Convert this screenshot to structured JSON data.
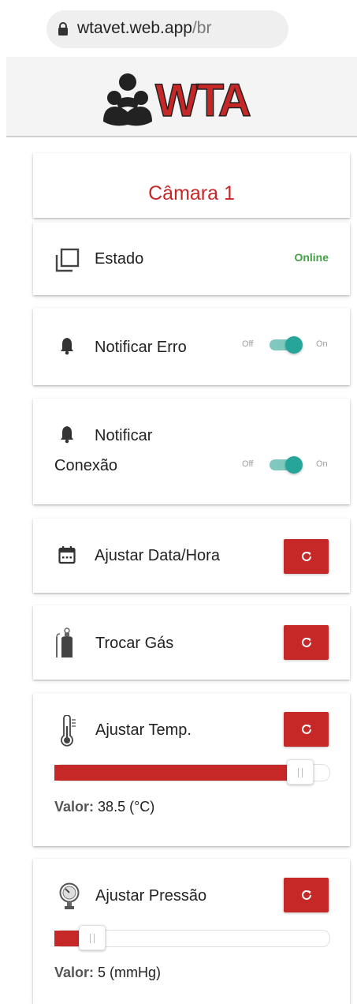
{
  "browser": {
    "url_domain": "wtavet.web.app",
    "url_path": "/br"
  },
  "header": {
    "logo_text": "WTA"
  },
  "chamber": {
    "title": "Câmara 1"
  },
  "status": {
    "label": "Estado",
    "value": "Online",
    "value_color": "#43a047"
  },
  "notify_error": {
    "label": "Notificar Erro",
    "off_label": "Off",
    "on_label": "On",
    "enabled": true
  },
  "notify_connection": {
    "label_line1": "Notificar",
    "label_line2": "Conexão",
    "off_label": "Off",
    "on_label": "On",
    "enabled": true
  },
  "set_datetime": {
    "label": "Ajustar Data/Hora"
  },
  "change_gas": {
    "label": "Trocar Gás"
  },
  "temperature": {
    "label": "Ajustar Temp.",
    "value_label": "Valor:",
    "value_text": "38.5 (°C)",
    "level": 0.94
  },
  "pressure": {
    "label": "Ajustar Pressão",
    "value_label": "Valor:",
    "value_text": "5 (mmHg)",
    "level": 0.1
  },
  "colors": {
    "accent": "#c62828",
    "switch": "#26a69a",
    "online": "#43a047"
  }
}
